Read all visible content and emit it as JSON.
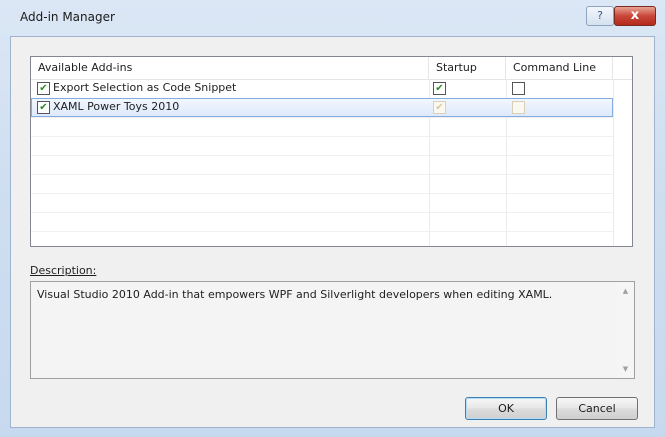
{
  "window": {
    "title": "Add-in Manager",
    "help_glyph": "?",
    "close_glyph": "x"
  },
  "addins": {
    "columns": [
      "Available Add-ins",
      "Startup",
      "Command Line"
    ],
    "rows": [
      {
        "name": "Export Selection as Code Snippet",
        "enabled": true,
        "startup": true,
        "command_line": false,
        "selected": false
      },
      {
        "name": "XAML Power Toys 2010",
        "enabled": true,
        "startup": true,
        "command_line": false,
        "selected": true
      }
    ]
  },
  "description": {
    "label": "Description:",
    "text": "Visual Studio 2010 Add-in that empowers WPF and Silverlight developers when editing XAML."
  },
  "buttons": {
    "ok": "OK",
    "cancel": "Cancel"
  },
  "icons": {
    "check": "✔",
    "scroll_up": "▲",
    "scroll_down": "▼"
  }
}
